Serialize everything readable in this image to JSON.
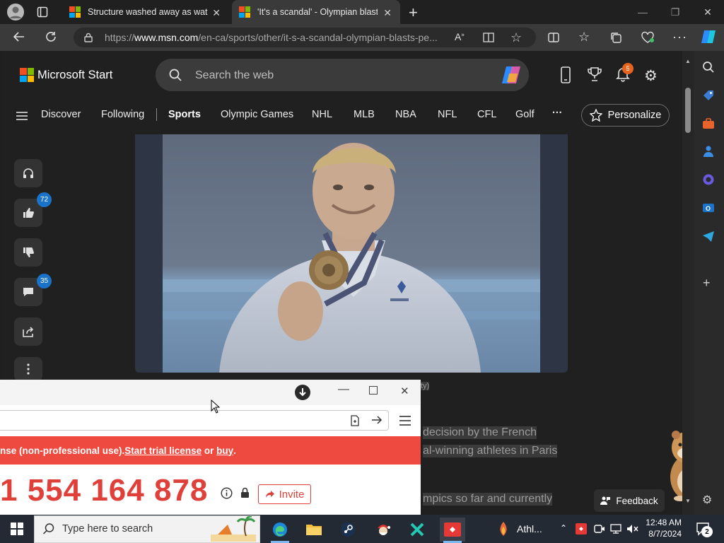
{
  "browser": {
    "tabs": [
      {
        "title": "Structure washed away as water",
        "active": false
      },
      {
        "title": "'It's a scandal' - Olympian blasts",
        "active": true
      }
    ],
    "url": {
      "prefix": "https://",
      "domain": "www.msn.com",
      "path": "/en-ca/sports/other/it-s-a-scandal-olympian-blasts-pe..."
    }
  },
  "header": {
    "brand": "Microsoft Start",
    "search_placeholder": "Search the web",
    "notification_count": "5"
  },
  "nav": {
    "items": [
      "Discover",
      "Following",
      "Sports",
      "Olympic Games",
      "NHL",
      "MLB",
      "NBA",
      "NFL",
      "CFL",
      "Golf"
    ],
    "more": "···",
    "personalize": "Personalize"
  },
  "actions": {
    "likes": "72",
    "comments": "35"
  },
  "article": {
    "caption_fragment": "ty)",
    "lines": [
      "decision by the French",
      "al-winning athletes in Paris",
      "mpics so far and currently"
    ]
  },
  "feedback_label": "Feedback",
  "overlay": {
    "banner_text": "nse (non-professional use). ",
    "banner_link1": "Start trial license",
    "banner_or": " or ",
    "banner_link2": "buy",
    "banner_end": ".",
    "id_number": "1 554 164 878",
    "invite_label": "Invite"
  },
  "taskbar": {
    "search_placeholder": "Type here to search",
    "app_label": "Athl...",
    "time": "12:48 AM",
    "date": "8/7/2024",
    "notification_count": "2"
  },
  "colors": {
    "accent_blue": "#1a73c9",
    "banner_red": "#ef4a3f",
    "notification_orange": "#e8641e"
  }
}
